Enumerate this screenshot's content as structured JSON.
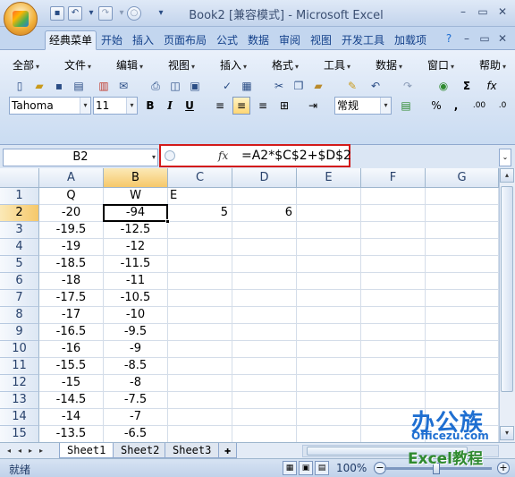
{
  "window": {
    "title": "Book2  [兼容模式] - Microsoft Excel",
    "quick_access": [
      "save-icon",
      "undo-icon",
      "redo-icon",
      "circle-icon",
      "customize-icon"
    ],
    "controls": {
      "minimize": "–",
      "restore": "▭",
      "close": "✕"
    }
  },
  "tabs": [
    "经典菜单",
    "开始",
    "插入",
    "页面布局",
    "公式",
    "数据",
    "审阅",
    "视图",
    "开发工具",
    "加载项"
  ],
  "ribbon_controls": {
    "help": "?",
    "minimize": "–",
    "restore": "▭",
    "close": "✕"
  },
  "menus": [
    "全部",
    "文件",
    "编辑",
    "视图",
    "插入",
    "格式",
    "工具",
    "数据",
    "窗口",
    "帮助"
  ],
  "format": {
    "font": "Tahoma",
    "size": "11",
    "bold": "B",
    "italic": "I",
    "underline": "U",
    "number_format": "常规",
    "percent": "%",
    "comma": ",",
    "sigma": "Σ",
    "fx": "fx"
  },
  "formula_bar": {
    "name_box": "B2",
    "fx": "fx",
    "formula": "=A2*$C$2+$D$2"
  },
  "sheet": {
    "columns": [
      "A",
      "B",
      "C",
      "D",
      "E",
      "F",
      "G"
    ],
    "selected_column": "B",
    "selected_row": 2,
    "row_numbers": [
      "1",
      "2",
      "3",
      "4",
      "5",
      "6",
      "7",
      "8",
      "9",
      "10",
      "11",
      "12",
      "13",
      "14",
      "15"
    ],
    "rows": [
      {
        "A": "Q",
        "B": "W",
        "C": "E",
        "D": ""
      },
      {
        "A": "-20",
        "B": "-94",
        "C": "5",
        "D": "6"
      },
      {
        "A": "-19.5",
        "B": "-12.5",
        "C": "",
        "D": ""
      },
      {
        "A": "-19",
        "B": "-12",
        "C": "",
        "D": ""
      },
      {
        "A": "-18.5",
        "B": "-11.5",
        "C": "",
        "D": ""
      },
      {
        "A": "-18",
        "B": "-11",
        "C": "",
        "D": ""
      },
      {
        "A": "-17.5",
        "B": "-10.5",
        "C": "",
        "D": ""
      },
      {
        "A": "-17",
        "B": "-10",
        "C": "",
        "D": ""
      },
      {
        "A": "-16.5",
        "B": "-9.5",
        "C": "",
        "D": ""
      },
      {
        "A": "-16",
        "B": "-9",
        "C": "",
        "D": ""
      },
      {
        "A": "-15.5",
        "B": "-8.5",
        "C": "",
        "D": ""
      },
      {
        "A": "-15",
        "B": "-8",
        "C": "",
        "D": ""
      },
      {
        "A": "-14.5",
        "B": "-7.5",
        "C": "",
        "D": ""
      },
      {
        "A": "-14",
        "B": "-7",
        "C": "",
        "D": ""
      },
      {
        "A": "-13.5",
        "B": "-6.5",
        "C": "",
        "D": ""
      }
    ]
  },
  "sheet_tabs": [
    "Sheet1",
    "Sheet2",
    "Sheet3"
  ],
  "status_bar": {
    "status": "就绪",
    "zoom": "100%"
  },
  "watermark": {
    "line1": "办公族",
    "line2": "Officezu.com",
    "line3": "Excel教程"
  }
}
